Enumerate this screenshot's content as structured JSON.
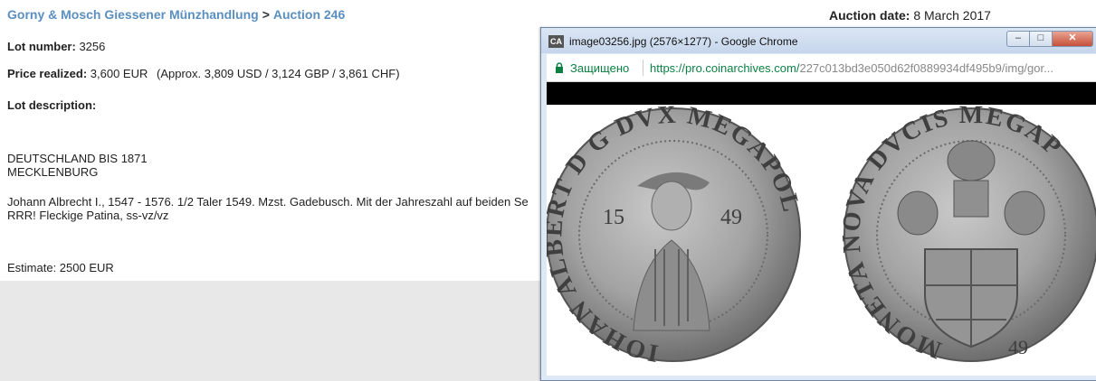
{
  "breadcrumb": {
    "house": "Gorny & Mosch Giessener Münzhandlung",
    "separator": ">",
    "auction": "Auction 246"
  },
  "auction_date": {
    "label": "Auction date:",
    "value": "8 March 2017"
  },
  "lot_number": {
    "label": "Lot number:",
    "value": "3256"
  },
  "price": {
    "label": "Price realized:",
    "value": "3,600 EUR",
    "approx": "(Approx. 3,809 USD / 3,124 GBP / 3,861 CHF)"
  },
  "lot_description": {
    "label": "Lot description:"
  },
  "description": {
    "line1": "DEUTSCHLAND BIS 1871",
    "line2": "MECKLENBURG",
    "line3": "Johann Albrecht I., 1547 - 1576. 1/2 Taler 1549. Mzst. Gadebusch. Mit der Jahreszahl auf beiden Se",
    "line4": "RRR! Fleckige Patina, ss-vz/vz"
  },
  "estimate": "Estimate: 2500 EUR",
  "popup": {
    "logo": "CA",
    "title": "image03256.jpg (2576×1277) - Google Chrome",
    "secure_label": "Защищено",
    "url_main": "https://pro.coinarchives.com/",
    "url_rest": "227c013bd3e050d62f0889934df495b9/img/gor...",
    "min_glyph": "–",
    "max_glyph": "□",
    "close_glyph": "✕"
  },
  "coin": {
    "obverse_legend": "IOHAN ALBERT D G DVX MEGAPOL",
    "obverse_year_left": "15",
    "obverse_year_right": "49",
    "reverse_legend": "MONETA NOVA DVCIS MEGAP",
    "reverse_year": "49"
  },
  "colors": {
    "link": "#5a8fbf",
    "secure_green": "#0b8043",
    "coin_silver": "#9a9a9a"
  }
}
